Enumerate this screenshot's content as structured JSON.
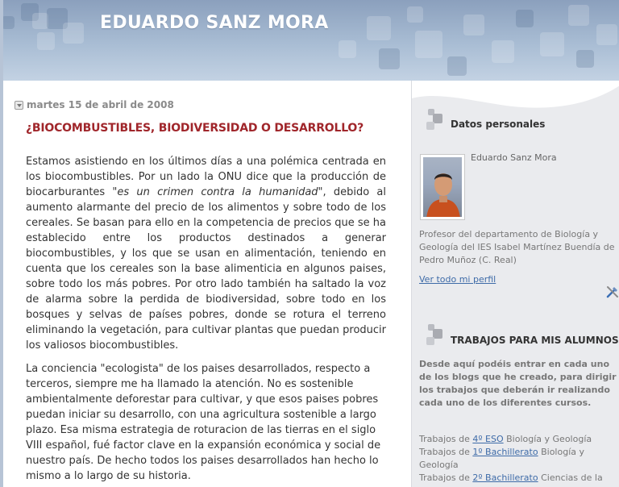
{
  "header": {
    "blog_title": "EDUARDO SANZ MORA"
  },
  "post": {
    "date": "martes 15 de abril de 2008",
    "title": "¿BIOCOMBUSTIBLES, BIODIVERSIDAD O DESARROLLO?",
    "p1_before": "Estamos asistiendo en los últimos días a una polémica centrada en los biocombustibles. Por un lado la ONU dice que la producción de biocarburantes ",
    "p1_quote": "\"es un crimen contra la humanidad\"",
    "p1_after": ", debido al aumento alarmante del precio de los alimentos y sobre todo de los cereales. Se basan para ello en la competencia de precios que se ha establecido entre los productos destinados a generar biocombustibles, y los que se usan en alimentación, teniendo en cuenta que los cereales son la base alimenticia en algunos paises, sobre todo los más pobres. Por otro lado también ha saltado la voz de alarma sobre la perdida de biodiversidad, sobre todo en los bosques y selvas de países pobres, donde se rotura el terreno eliminando la vegetación, para cultivar plantas que puedan producir los valiosos biocombustibles.",
    "p2": "La conciencia \"ecologista\" de los paises desarrollados, respecto a terceros, siempre me ha llamado la atención. No es sostenible ambientalmente deforestar para cultivar, y que esos paises pobres puedan iniciar su desarrollo, con una agricultura sostenible a largo plazo. Esa misma estrategia de roturacion de las tierras en el siglo VIII español, fué factor clave en la expansión económica y social de nuestro país. De hecho todos los paises desarrollados han hecho lo mismo a lo largo de su historia."
  },
  "sidebar": {
    "profile": {
      "heading": "Datos personales",
      "name": "Eduardo Sanz Mora",
      "description": "Profesor del departamento de Biología y Geología del IES Isabel Martínez Buendía de Pedro Muñoz (C. Real)",
      "link": "Ver todo mi perfil"
    },
    "trabajos": {
      "heading": "TRABAJOS PARA MIS ALUMNOS",
      "intro": "Desde aquí podéis entrar en cada uno de los blogs que he creado, para dirigir los trabajos que deberán ir realizando cada uno de los diferentes cursos.",
      "items": [
        {
          "prefix": "Trabajos de ",
          "link": "4º ESO",
          "suffix": " Biología y Geología"
        },
        {
          "prefix": "Trabajos de ",
          "link": "1º Bachillerato",
          "suffix": " Biología y Geología"
        },
        {
          "prefix": "Trabajos de ",
          "link": "2º Bachillerato",
          "suffix": " Ciencias de la Tierra y Medio Ambiente"
        }
      ]
    }
  },
  "colors": {
    "post_title": "#a0262b",
    "link": "#3e6ba8",
    "header": "#a9bdd4"
  }
}
